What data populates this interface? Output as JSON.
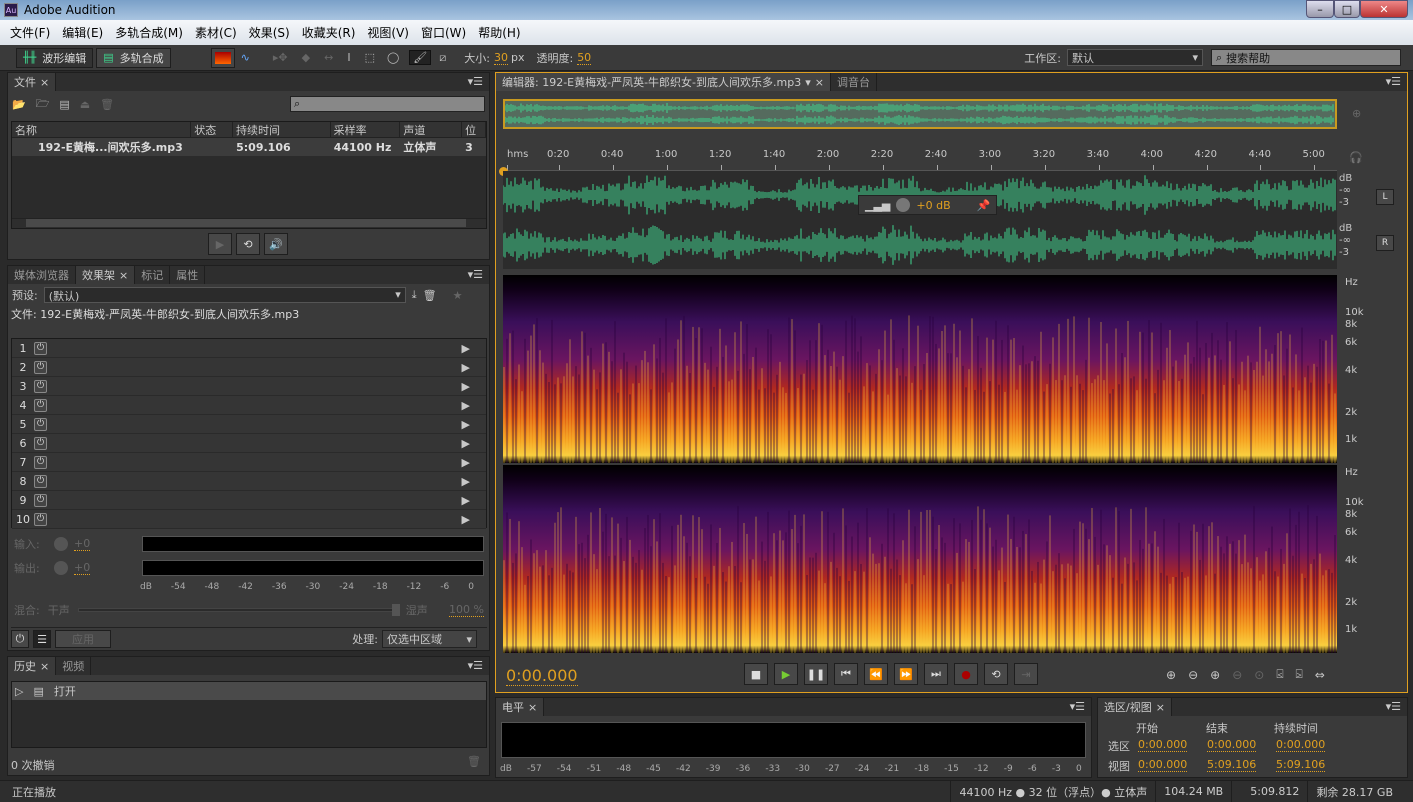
{
  "app": {
    "title": "Adobe Audition",
    "logo": "Au"
  },
  "menu": [
    "文件(F)",
    "编辑(E)",
    "多轨合成(M)",
    "素材(C)",
    "效果(S)",
    "收藏夹(R)",
    "视图(V)",
    "窗口(W)",
    "帮助(H)"
  ],
  "toolbar": {
    "waveform_label": "波形编辑",
    "multitrack_label": "多轨合成",
    "size_label": "大小:",
    "size_value": "30",
    "size_unit": "px",
    "opacity_label": "透明度:",
    "opacity_value": "50",
    "workspace_label": "工作区:",
    "workspace_value": "默认",
    "search_placeholder": "搜索帮助"
  },
  "files": {
    "tab": "文件",
    "columns": [
      "名称",
      "状态",
      "持续时间",
      "采样率",
      "声道",
      "位"
    ],
    "rows": [
      {
        "name": "192-E黄梅...间欢乐多.mp3",
        "status": "",
        "duration": "5:09.106",
        "rate": "44100 Hz",
        "channels": "立体声",
        "bits": "3"
      }
    ]
  },
  "effects": {
    "tabs": [
      "媒体浏览器",
      "效果架",
      "标记",
      "属性"
    ],
    "preset_label": "预设:",
    "preset_value": "(默认)",
    "file_label": "文件: 192-E黄梅戏-严凤英-牛郎织女-到底人间欢乐多.mp3",
    "slots": [
      "1",
      "2",
      "3",
      "4",
      "5",
      "6",
      "7",
      "8",
      "9",
      "10"
    ],
    "input_label": "输入:",
    "input_value": "+0",
    "output_label": "输出:",
    "output_value": "+0",
    "scale": [
      "dB",
      "-54",
      "-48",
      "-42",
      "-36",
      "-30",
      "-24",
      "-18",
      "-12",
      "-6",
      "0"
    ],
    "mix_label": "混合:",
    "dry_label": "干声",
    "wet_label": "湿声",
    "mix_value": "100 %",
    "apply_label": "应用",
    "process_label": "处理:",
    "process_value": "仅选中区域"
  },
  "history": {
    "tabs": [
      "历史",
      "视频"
    ],
    "items": [
      "打开"
    ],
    "undo_count": "0 次撤销"
  },
  "editor": {
    "tab": "编辑器: 192-E黄梅戏-严凤英-牛郎织女-到底人间欢乐多.mp3",
    "tab2": "调音台",
    "ruler": [
      "hms",
      "0:20",
      "0:40",
      "1:00",
      "1:20",
      "1:40",
      "2:00",
      "2:20",
      "2:40",
      "3:00",
      "3:20",
      "3:40",
      "4:00",
      "4:20",
      "4:40",
      "5:00"
    ],
    "db_labels": [
      "dB",
      "-∞",
      "-3"
    ],
    "channels": [
      "L",
      "R"
    ],
    "hud_gain": "+0 dB",
    "hz_labels": [
      "Hz",
      "10k",
      "8k",
      "6k",
      "4k",
      "2k",
      "1k"
    ],
    "time": "0:00.000",
    "accent": "#e0a020",
    "wave_color": "#3fd68f"
  },
  "levels": {
    "tab": "电平",
    "scale": [
      "dB",
      "-57",
      "-54",
      "-51",
      "-48",
      "-45",
      "-42",
      "-39",
      "-36",
      "-33",
      "-30",
      "-27",
      "-24",
      "-21",
      "-18",
      "-15",
      "-12",
      "-9",
      "-6",
      "-3",
      "0"
    ]
  },
  "selection": {
    "tab": "选区/视图",
    "headers": [
      "开始",
      "结束",
      "持续时间"
    ],
    "rows": [
      {
        "label": "选区",
        "start": "0:00.000",
        "end": "0:00.000",
        "duration": "0:00.000"
      },
      {
        "label": "视图",
        "start": "0:00.000",
        "end": "5:09.106",
        "duration": "5:09.106"
      }
    ]
  },
  "status": {
    "left": "正在播放",
    "format": "44100 Hz ● 32 位（浮点）● 立体声",
    "size": "104.24 MB",
    "duration": "5:09.812",
    "free": "剩余 28.17 GB"
  }
}
